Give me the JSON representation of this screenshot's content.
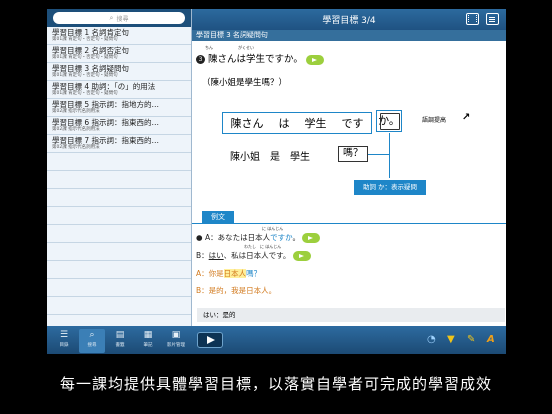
{
  "search": {
    "placeholder": "搜尋"
  },
  "lessons": [
    {
      "title": "學習目標 1 名詞肯定句",
      "subtitle": "第01課 肯定句・否定句・疑問句"
    },
    {
      "title": "學習目標 2 名詞否定句",
      "subtitle": "第01課 肯定句・否定句・疑問句"
    },
    {
      "title": "學習目標 3 名詞疑問句",
      "subtitle": "第01課 肯定句・否定句・疑問句"
    },
    {
      "title": "學習目標 4 助詞：「の」的用法",
      "subtitle": "第01課 肯定句・否定句・疑問句"
    },
    {
      "title": "學習目標 5 指示詞：指地方的…",
      "subtitle": "第02課 指示代名詞用法"
    },
    {
      "title": "學習目標 6 指示詞：指東西的…",
      "subtitle": "第02課 指示代名詞用法"
    },
    {
      "title": "學習目標 7 指示詞：指東西的…",
      "subtitle": "第02課 指示代名詞用法"
    }
  ],
  "topbar": {
    "title": "學習目標 3/4",
    "icons": [
      "film-icon",
      "clipboard-icon"
    ]
  },
  "section": {
    "header": "學習目標 3 名詞疑問句"
  },
  "main": {
    "sentence_number": "3",
    "ruby_san": "ちん",
    "ruby_gakusei": "がくせい",
    "sentence_jp": "陳さんは学生ですか。",
    "translation": "（陳小姐是學生嗎？）",
    "jp_words": [
      "陳さん",
      "は",
      "学生",
      "です"
    ],
    "ka": "か。",
    "tone_note": "語調提高",
    "zh_words": "陳小姐　是　學生",
    "zh_ma": "嗎？",
    "particle_note": "助詞 か：表示疑問",
    "example_tab": "例文",
    "ex1_a": "A：あなたは",
    "ex1_b": "日本人",
    "ex1_c": "ですか",
    "ex1_d": "。",
    "ex1_ruby": "に ほんじん",
    "ex2_a": "B：",
    "ex2_b": "はい",
    "ex2_c": "、私は日本人です。",
    "ex2_ruby": "わたし　に ほんじん",
    "ex3_a": "A：你是",
    "ex3_b": "日本人",
    "ex3_c": "嗎？",
    "ex4": "B：是的，我是日本人。",
    "note": "はい：是的"
  },
  "bottombar": {
    "tabs": [
      {
        "label": "目錄",
        "icon": "list-icon"
      },
      {
        "label": "搜尋",
        "icon": "search-icon"
      },
      {
        "label": "書籤",
        "icon": "book-icon"
      },
      {
        "label": "筆記",
        "icon": "note-icon"
      },
      {
        "label": "影片管理",
        "icon": "video-manage-icon"
      }
    ],
    "active_tab": "搜尋",
    "right_icons": [
      "speedometer-icon",
      "bookmark-add-icon",
      "edit-icon",
      "font-size-icon"
    ]
  },
  "caption": "每一課均提供具體學習目標，以落實自學者可完成的學習成效",
  "colors": {
    "accent": "#1e86c8",
    "bar": "#1f5282",
    "speaker": "#9ccf3d",
    "highlight": "#ffef9a"
  }
}
